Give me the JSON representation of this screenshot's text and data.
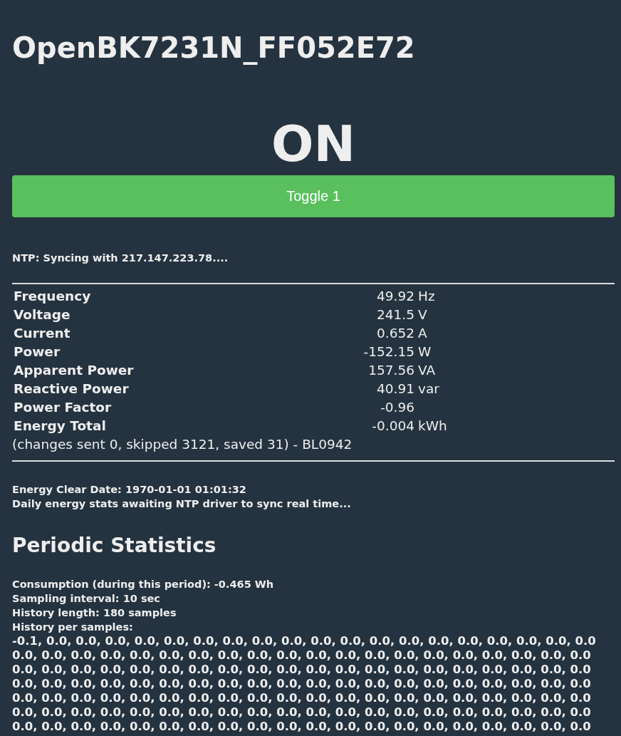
{
  "device_title": "OpenBK7231N_FF052E72",
  "relay_state": "ON",
  "toggle_button": {
    "label": "Toggle 1"
  },
  "ntp_status": "NTP: Syncing with 217.147.223.78....",
  "measurements": [
    {
      "label": "Frequency",
      "value": "49.92",
      "unit": "Hz"
    },
    {
      "label": "Voltage",
      "value": "241.5",
      "unit": "V"
    },
    {
      "label": "Current",
      "value": "0.652",
      "unit": "A"
    },
    {
      "label": "Power",
      "value": "-152.15",
      "unit": "W"
    },
    {
      "label": "Apparent Power",
      "value": "157.56",
      "unit": "VA"
    },
    {
      "label": "Reactive Power",
      "value": "40.91",
      "unit": "var"
    },
    {
      "label": "Power Factor",
      "value": "-0.96"
    },
    {
      "label": "Energy Total",
      "value": "-0.004",
      "unit": "kWh"
    }
  ],
  "energy_note": "(changes sent 0, skipped 3121, saved 31) - BL0942",
  "energy_info": [
    "Energy Clear Date: 1970-01-01 01:01:32",
    "Daily energy stats awaiting NTP driver to sync real time..."
  ],
  "periodic_statistics": {
    "title": "Periodic Statistics",
    "lines": [
      "Consumption (during this period): -0.465 Wh",
      "Sampling interval: 10 sec",
      "History length: 180 samples",
      "History per samples:"
    ],
    "history": [
      "-0.1, 0.0, 0.0, 0.0, 0.0, 0.0, 0.0, 0.0, 0.0, 0.0, 0.0, 0.0, 0.0, 0.0, 0.0, 0.0, 0.0, 0.0, 0.0, 0.0",
      "0.0, 0.0, 0.0, 0.0, 0.0, 0.0, 0.0, 0.0, 0.0, 0.0, 0.0, 0.0, 0.0, 0.0, 0.0, 0.0, 0.0, 0.0, 0.0, 0.0",
      "0.0, 0.0, 0.0, 0.0, 0.0, 0.0, 0.0, 0.0, 0.0, 0.0, 0.0, 0.0, 0.0, 0.0, 0.0, 0.0, 0.0, 0.0, 0.0, 0.0",
      "0.0, 0.0, 0.0, 0.0, 0.0, 0.0, 0.0, 0.0, 0.0, 0.0, 0.0, 0.0, 0.0, 0.0, 0.0, 0.0, 0.0, 0.0, 0.0, 0.0",
      "0.0, 0.0, 0.0, 0.0, 0.0, 0.0, 0.0, 0.0, 0.0, 0.0, 0.0, 0.0, 0.0, 0.0, 0.0, 0.0, 0.0, 0.0, 0.0, 0.0",
      "0.0, 0.0, 0.0, 0.0, 0.0, 0.0, 0.0, 0.0, 0.0, 0.0, 0.0, 0.0, 0.0, 0.0, 0.0, 0.0, 0.0, 0.0, 0.0, 0.0",
      "0.0, 0.0, 0.0, 0.0, 0.0, 0.0, 0.0, 0.0, 0.0, 0.0, 0.0, 0.0, 0.0, 0.0, 0.0, 0.0, 0.0, 0.0, 0.0, 0.0"
    ]
  }
}
